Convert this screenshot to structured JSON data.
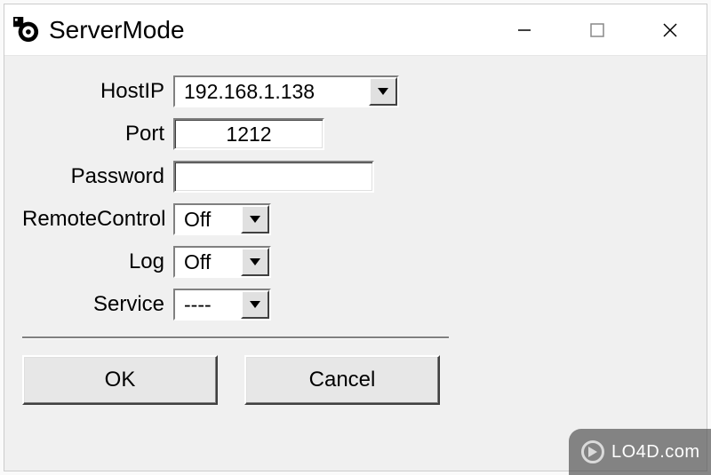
{
  "window": {
    "title": "ServerMode"
  },
  "fields": {
    "hostip": {
      "label": "HostIP",
      "value": "192.168.1.138"
    },
    "port": {
      "label": "Port",
      "value": "1212"
    },
    "password": {
      "label": "Password",
      "value": ""
    },
    "remotecontrol": {
      "label": "RemoteControl",
      "value": "Off"
    },
    "log": {
      "label": "Log",
      "value": "Off"
    },
    "service": {
      "label": "Service",
      "value": "----"
    }
  },
  "buttons": {
    "ok": "OK",
    "cancel": "Cancel"
  },
  "watermark": {
    "text": "LO4D.com"
  }
}
